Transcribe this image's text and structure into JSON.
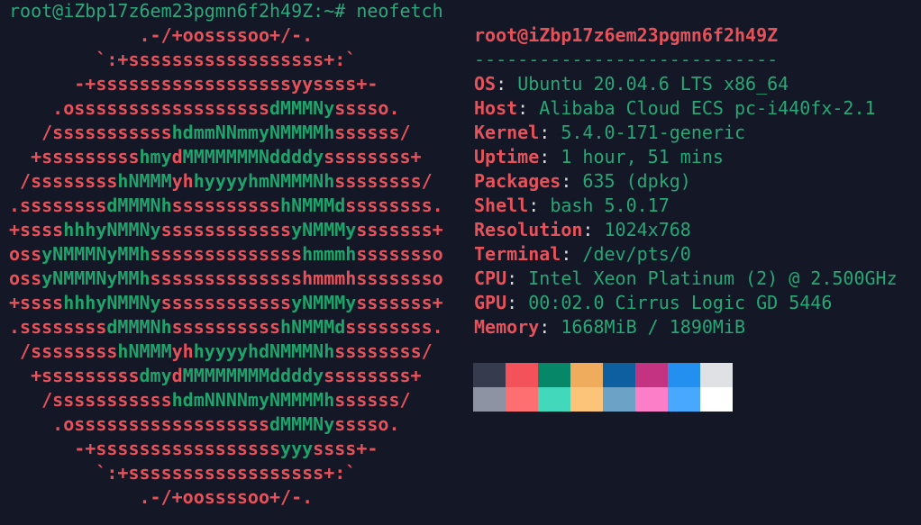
{
  "terminal": {
    "prompt": "root@iZbp17z6em23pgmn6f2h49Z:~# neofetch",
    "colors": {
      "background": "#141726",
      "ascii_primary": "#e5525a",
      "ascii_secondary": "#1fa36a",
      "value": "#26a874"
    },
    "ascii_art": [
      [
        [
          "r",
          "            .-/+oossssoo+/-."
        ]
      ],
      [
        [
          "r",
          "        `:+ssssssssssssssssss+:`"
        ]
      ],
      [
        [
          "r",
          "      -+ssssssssssssssssssyyssss+-"
        ]
      ],
      [
        [
          "r",
          "    .ossssssssssssssssss"
        ],
        [
          "g",
          "dMMMNy"
        ],
        [
          "r",
          "sssso."
        ]
      ],
      [
        [
          "r",
          "   /sssssssssss"
        ],
        [
          "g",
          "hdmmNNmmyNMMMMh"
        ],
        [
          "r",
          "ssssss/"
        ]
      ],
      [
        [
          "r",
          "  +sssssssss"
        ],
        [
          "g",
          "hmy"
        ],
        [
          "r",
          "d"
        ],
        [
          "g",
          "MMMMMMMNddddy"
        ],
        [
          "r",
          "ssssssss+"
        ]
      ],
      [
        [
          "r",
          " /ssssssss"
        ],
        [
          "g",
          "hNMMM"
        ],
        [
          "r",
          "yh"
        ],
        [
          "g",
          "hyyyyhmNMMMNh"
        ],
        [
          "r",
          "ssssssss/"
        ]
      ],
      [
        [
          "r",
          ".ssssssss"
        ],
        [
          "g",
          "dMMMNh"
        ],
        [
          "r",
          "ssssssssss"
        ],
        [
          "g",
          "hNMMMd"
        ],
        [
          "r",
          "ssssssss."
        ]
      ],
      [
        [
          "r",
          "+ssss"
        ],
        [
          "g",
          "hhhyNMMNy"
        ],
        [
          "r",
          "ssssssssssss"
        ],
        [
          "g",
          "yNMMMy"
        ],
        [
          "r",
          "sssssss+"
        ]
      ],
      [
        [
          "r",
          "oss"
        ],
        [
          "g",
          "yNMMMNyMMh"
        ],
        [
          "r",
          "ssssssssssssss"
        ],
        [
          "g",
          "hmmmh"
        ],
        [
          "r",
          "ssssssso"
        ]
      ],
      [
        [
          "r",
          "oss"
        ],
        [
          "g",
          "yNMMMNyMMh"
        ],
        [
          "r",
          "sssssssssssssshmmmhssssssso"
        ]
      ],
      [
        [
          "r",
          "+ssss"
        ],
        [
          "g",
          "hhhyNMMNy"
        ],
        [
          "r",
          "ssssssssssss"
        ],
        [
          "g",
          "yNMMMy"
        ],
        [
          "r",
          "sssssss+"
        ]
      ],
      [
        [
          "r",
          ".ssssssss"
        ],
        [
          "g",
          "dMMMNh"
        ],
        [
          "r",
          "ssssssssss"
        ],
        [
          "g",
          "hNMMMd"
        ],
        [
          "r",
          "ssssssss."
        ]
      ],
      [
        [
          "r",
          " /ssssssss"
        ],
        [
          "g",
          "hNMMM"
        ],
        [
          "r",
          "yh"
        ],
        [
          "g",
          "hyyyyhdNMMMNh"
        ],
        [
          "r",
          "ssssssss/"
        ]
      ],
      [
        [
          "r",
          "  +sssssssss"
        ],
        [
          "g",
          "dmy"
        ],
        [
          "r",
          "d"
        ],
        [
          "g",
          "MMMMMMMMddddy"
        ],
        [
          "r",
          "ssssssss+"
        ]
      ],
      [
        [
          "r",
          "   /sssssssssss"
        ],
        [
          "g",
          "hdmNNNNmyNMMMMh"
        ],
        [
          "r",
          "ssssss/"
        ]
      ],
      [
        [
          "r",
          "    .ossssssssssssssssss"
        ],
        [
          "g",
          "dMMMNy"
        ],
        [
          "r",
          "sssso."
        ]
      ],
      [
        [
          "r",
          "      -+sssssssssssssssss"
        ],
        [
          "g",
          "yyy"
        ],
        [
          "r",
          "ssss+-"
        ]
      ],
      [
        [
          "r",
          "        `:+ssssssssssssssssss+:`"
        ]
      ],
      [
        [
          "r",
          "            .-/+oossssoo+/-."
        ]
      ]
    ]
  },
  "info": {
    "title": "root@iZbp17z6em23pgmn6f2h49Z",
    "separator": "----------------------------",
    "fields": [
      {
        "label": "OS",
        "value": "Ubuntu 20.04.6 LTS x86_64"
      },
      {
        "label": "Host",
        "value": "Alibaba Cloud ECS pc-i440fx-2.1"
      },
      {
        "label": "Kernel",
        "value": "5.4.0-171-generic"
      },
      {
        "label": "Uptime",
        "value": "1 hour, 51 mins"
      },
      {
        "label": "Packages",
        "value": "635 (dpkg)"
      },
      {
        "label": "Shell",
        "value": "bash 5.0.17"
      },
      {
        "label": "Resolution",
        "value": "1024x768"
      },
      {
        "label": "Terminal",
        "value": "/dev/pts/0"
      },
      {
        "label": "CPU",
        "value": "Intel Xeon Platinum (2) @ 2.500GHz"
      },
      {
        "label": "GPU",
        "value": "00:02.0 Cirrus Logic GD 5446"
      },
      {
        "label": "Memory",
        "value": "1668MiB / 1890MiB"
      }
    ],
    "colon": ":",
    "palette": [
      [
        "#363b4e",
        "#f4525a",
        "#068767",
        "#eeac5c",
        "#0e5fa0",
        "#c33382",
        "#2390f0",
        "#dfe1e5"
      ],
      [
        "#8e93a4",
        "#fe6f72",
        "#42d8bc",
        "#fbc479",
        "#6ca2c6",
        "#fd7ec8",
        "#47a8fe",
        "#ffffff"
      ]
    ]
  }
}
